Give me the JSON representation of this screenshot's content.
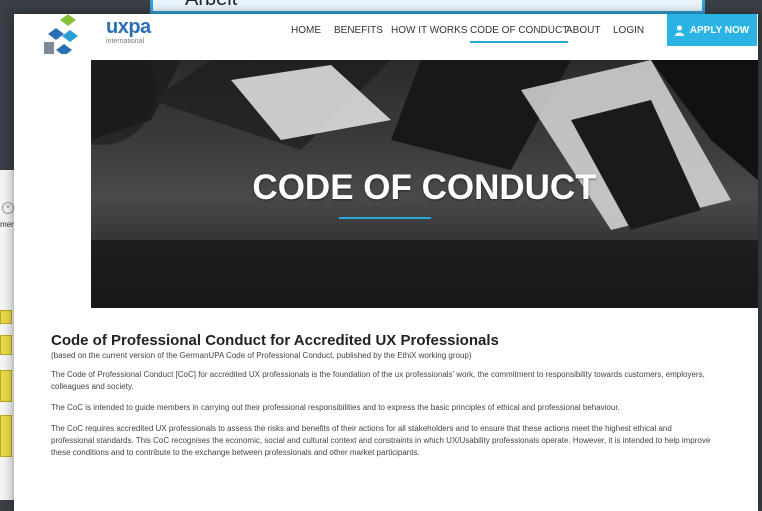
{
  "background": {
    "top_bar_text": "Arbeit",
    "side_window_text": "men"
  },
  "logo": {
    "name": "uxpa",
    "sub": "international"
  },
  "nav": {
    "items": [
      {
        "label": "HOME"
      },
      {
        "label": "BENEFITS"
      },
      {
        "label": "HOW IT WORKS"
      },
      {
        "label": "CODE OF CONDUCT"
      },
      {
        "label": "ABOUT"
      },
      {
        "label": "LOGIN"
      }
    ],
    "active_index": 3,
    "apply_label": "APPLY NOW"
  },
  "hero": {
    "title": "CODE OF CONDUCT"
  },
  "content": {
    "heading": "Code of Professional Conduct for Accredited UX Professionals",
    "subtitle": "(based on the current version of the GermanUPA Code of Professional Conduct, published by the EthiX working group)",
    "paragraphs": [
      "The Code of Professional Conduct [CoC] for accredited UX professionals is the foundation of the ux professionals’ work, the commitment to responsibility towards customers, employers, colleagues and society.",
      "The CoC is intended to guide members in carrying out their professional responsibilities and to express the basic principles of ethical and professional behaviour.",
      "The CoC requires accredited UX professionals to assess the risks and benefits of their actions for all stakeholders and to ensure that these actions meet the highest ethical and professional standards. This CoC recognises the economic, social and cultural context and constraints in which UX/Usability professionals operate. However, it is intended to help improve these conditions and to contribute to the exchange between professionals and other market participants."
    ]
  },
  "colors": {
    "accent": "#2aa7d9",
    "button": "#2bb3e6",
    "logo_blue": "#2a6fb6"
  }
}
